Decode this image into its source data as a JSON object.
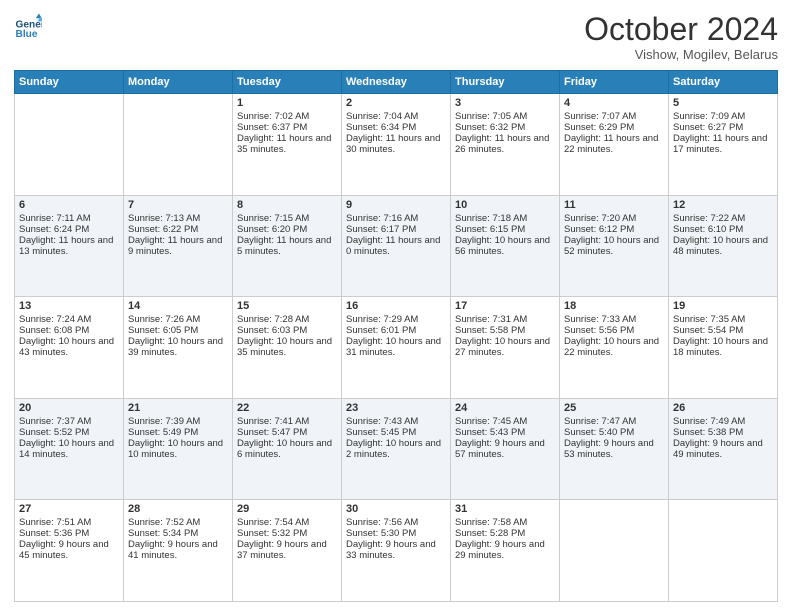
{
  "header": {
    "logo_line1": "General",
    "logo_line2": "Blue",
    "title": "October 2024",
    "subtitle": "Vishow, Mogilev, Belarus"
  },
  "weekdays": [
    "Sunday",
    "Monday",
    "Tuesday",
    "Wednesday",
    "Thursday",
    "Friday",
    "Saturday"
  ],
  "weeks": [
    [
      {
        "day": "",
        "sunrise": "",
        "sunset": "",
        "daylight": ""
      },
      {
        "day": "",
        "sunrise": "",
        "sunset": "",
        "daylight": ""
      },
      {
        "day": "1",
        "sunrise": "Sunrise: 7:02 AM",
        "sunset": "Sunset: 6:37 PM",
        "daylight": "Daylight: 11 hours and 35 minutes."
      },
      {
        "day": "2",
        "sunrise": "Sunrise: 7:04 AM",
        "sunset": "Sunset: 6:34 PM",
        "daylight": "Daylight: 11 hours and 30 minutes."
      },
      {
        "day": "3",
        "sunrise": "Sunrise: 7:05 AM",
        "sunset": "Sunset: 6:32 PM",
        "daylight": "Daylight: 11 hours and 26 minutes."
      },
      {
        "day": "4",
        "sunrise": "Sunrise: 7:07 AM",
        "sunset": "Sunset: 6:29 PM",
        "daylight": "Daylight: 11 hours and 22 minutes."
      },
      {
        "day": "5",
        "sunrise": "Sunrise: 7:09 AM",
        "sunset": "Sunset: 6:27 PM",
        "daylight": "Daylight: 11 hours and 17 minutes."
      }
    ],
    [
      {
        "day": "6",
        "sunrise": "Sunrise: 7:11 AM",
        "sunset": "Sunset: 6:24 PM",
        "daylight": "Daylight: 11 hours and 13 minutes."
      },
      {
        "day": "7",
        "sunrise": "Sunrise: 7:13 AM",
        "sunset": "Sunset: 6:22 PM",
        "daylight": "Daylight: 11 hours and 9 minutes."
      },
      {
        "day": "8",
        "sunrise": "Sunrise: 7:15 AM",
        "sunset": "Sunset: 6:20 PM",
        "daylight": "Daylight: 11 hours and 5 minutes."
      },
      {
        "day": "9",
        "sunrise": "Sunrise: 7:16 AM",
        "sunset": "Sunset: 6:17 PM",
        "daylight": "Daylight: 11 hours and 0 minutes."
      },
      {
        "day": "10",
        "sunrise": "Sunrise: 7:18 AM",
        "sunset": "Sunset: 6:15 PM",
        "daylight": "Daylight: 10 hours and 56 minutes."
      },
      {
        "day": "11",
        "sunrise": "Sunrise: 7:20 AM",
        "sunset": "Sunset: 6:12 PM",
        "daylight": "Daylight: 10 hours and 52 minutes."
      },
      {
        "day": "12",
        "sunrise": "Sunrise: 7:22 AM",
        "sunset": "Sunset: 6:10 PM",
        "daylight": "Daylight: 10 hours and 48 minutes."
      }
    ],
    [
      {
        "day": "13",
        "sunrise": "Sunrise: 7:24 AM",
        "sunset": "Sunset: 6:08 PM",
        "daylight": "Daylight: 10 hours and 43 minutes."
      },
      {
        "day": "14",
        "sunrise": "Sunrise: 7:26 AM",
        "sunset": "Sunset: 6:05 PM",
        "daylight": "Daylight: 10 hours and 39 minutes."
      },
      {
        "day": "15",
        "sunrise": "Sunrise: 7:28 AM",
        "sunset": "Sunset: 6:03 PM",
        "daylight": "Daylight: 10 hours and 35 minutes."
      },
      {
        "day": "16",
        "sunrise": "Sunrise: 7:29 AM",
        "sunset": "Sunset: 6:01 PM",
        "daylight": "Daylight: 10 hours and 31 minutes."
      },
      {
        "day": "17",
        "sunrise": "Sunrise: 7:31 AM",
        "sunset": "Sunset: 5:58 PM",
        "daylight": "Daylight: 10 hours and 27 minutes."
      },
      {
        "day": "18",
        "sunrise": "Sunrise: 7:33 AM",
        "sunset": "Sunset: 5:56 PM",
        "daylight": "Daylight: 10 hours and 22 minutes."
      },
      {
        "day": "19",
        "sunrise": "Sunrise: 7:35 AM",
        "sunset": "Sunset: 5:54 PM",
        "daylight": "Daylight: 10 hours and 18 minutes."
      }
    ],
    [
      {
        "day": "20",
        "sunrise": "Sunrise: 7:37 AM",
        "sunset": "Sunset: 5:52 PM",
        "daylight": "Daylight: 10 hours and 14 minutes."
      },
      {
        "day": "21",
        "sunrise": "Sunrise: 7:39 AM",
        "sunset": "Sunset: 5:49 PM",
        "daylight": "Daylight: 10 hours and 10 minutes."
      },
      {
        "day": "22",
        "sunrise": "Sunrise: 7:41 AM",
        "sunset": "Sunset: 5:47 PM",
        "daylight": "Daylight: 10 hours and 6 minutes."
      },
      {
        "day": "23",
        "sunrise": "Sunrise: 7:43 AM",
        "sunset": "Sunset: 5:45 PM",
        "daylight": "Daylight: 10 hours and 2 minutes."
      },
      {
        "day": "24",
        "sunrise": "Sunrise: 7:45 AM",
        "sunset": "Sunset: 5:43 PM",
        "daylight": "Daylight: 9 hours and 57 minutes."
      },
      {
        "day": "25",
        "sunrise": "Sunrise: 7:47 AM",
        "sunset": "Sunset: 5:40 PM",
        "daylight": "Daylight: 9 hours and 53 minutes."
      },
      {
        "day": "26",
        "sunrise": "Sunrise: 7:49 AM",
        "sunset": "Sunset: 5:38 PM",
        "daylight": "Daylight: 9 hours and 49 minutes."
      }
    ],
    [
      {
        "day": "27",
        "sunrise": "Sunrise: 7:51 AM",
        "sunset": "Sunset: 5:36 PM",
        "daylight": "Daylight: 9 hours and 45 minutes."
      },
      {
        "day": "28",
        "sunrise": "Sunrise: 7:52 AM",
        "sunset": "Sunset: 5:34 PM",
        "daylight": "Daylight: 9 hours and 41 minutes."
      },
      {
        "day": "29",
        "sunrise": "Sunrise: 7:54 AM",
        "sunset": "Sunset: 5:32 PM",
        "daylight": "Daylight: 9 hours and 37 minutes."
      },
      {
        "day": "30",
        "sunrise": "Sunrise: 7:56 AM",
        "sunset": "Sunset: 5:30 PM",
        "daylight": "Daylight: 9 hours and 33 minutes."
      },
      {
        "day": "31",
        "sunrise": "Sunrise: 7:58 AM",
        "sunset": "Sunset: 5:28 PM",
        "daylight": "Daylight: 9 hours and 29 minutes."
      },
      {
        "day": "",
        "sunrise": "",
        "sunset": "",
        "daylight": ""
      },
      {
        "day": "",
        "sunrise": "",
        "sunset": "",
        "daylight": ""
      }
    ]
  ]
}
